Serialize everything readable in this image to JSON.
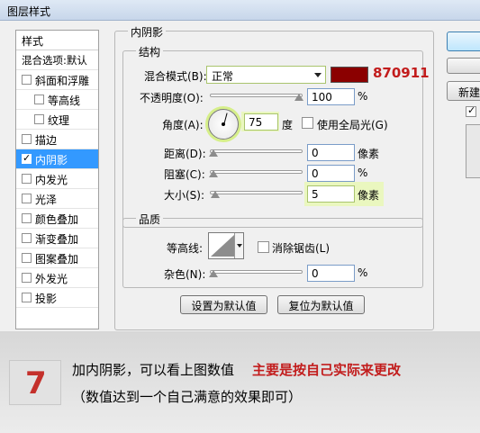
{
  "window": {
    "title": "图层样式"
  },
  "style_list": {
    "header": "样式",
    "blend_row": "混合选项:默认",
    "items": [
      {
        "label": "斜面和浮雕",
        "checked": false,
        "sub": false
      },
      {
        "label": "等高线",
        "checked": false,
        "sub": true
      },
      {
        "label": "纹理",
        "checked": false,
        "sub": true
      },
      {
        "label": "描边",
        "checked": false,
        "sub": false
      },
      {
        "label": "内阴影",
        "checked": true,
        "sub": false,
        "selected": true
      },
      {
        "label": "内发光",
        "checked": false,
        "sub": false
      },
      {
        "label": "光泽",
        "checked": false,
        "sub": false
      },
      {
        "label": "颜色叠加",
        "checked": false,
        "sub": false
      },
      {
        "label": "渐变叠加",
        "checked": false,
        "sub": false
      },
      {
        "label": "图案叠加",
        "checked": false,
        "sub": false
      },
      {
        "label": "外发光",
        "checked": false,
        "sub": false
      },
      {
        "label": "投影",
        "checked": false,
        "sub": false
      }
    ]
  },
  "panel": {
    "title": "内阴影",
    "structure": {
      "title": "结构",
      "blend_mode_label": "混合模式(B):",
      "blend_mode_value": "正常",
      "color_hex": "870911",
      "color": "#8b0000",
      "opacity_label": "不透明度(O):",
      "opacity_value": "100",
      "opacity_unit": "%",
      "angle_label": "角度(A):",
      "angle_value": "75",
      "angle_unit": "度",
      "global_light_label": "使用全局光(G)",
      "distance_label": "距离(D):",
      "distance_value": "0",
      "distance_unit": "像素",
      "choke_label": "阻塞(C):",
      "choke_value": "0",
      "choke_unit": "%",
      "size_label": "大小(S):",
      "size_value": "5",
      "size_unit": "像素"
    },
    "quality": {
      "title": "品质",
      "contour_label": "等高线:",
      "antialias_label": "消除锯齿(L)",
      "noise_label": "杂色(N):",
      "noise_value": "0",
      "noise_unit": "%"
    },
    "buttons": {
      "set_default": "设置为默认值",
      "reset_default": "复位为默认值"
    }
  },
  "right_buttons": {
    "new_style": "新建"
  },
  "caption": {
    "step": "7",
    "line1": "加内阴影，可以看上图数值",
    "line1_emphasis": "主要是按自己实际来更改",
    "line2": "（数值达到一个自己满意的效果即可）"
  }
}
